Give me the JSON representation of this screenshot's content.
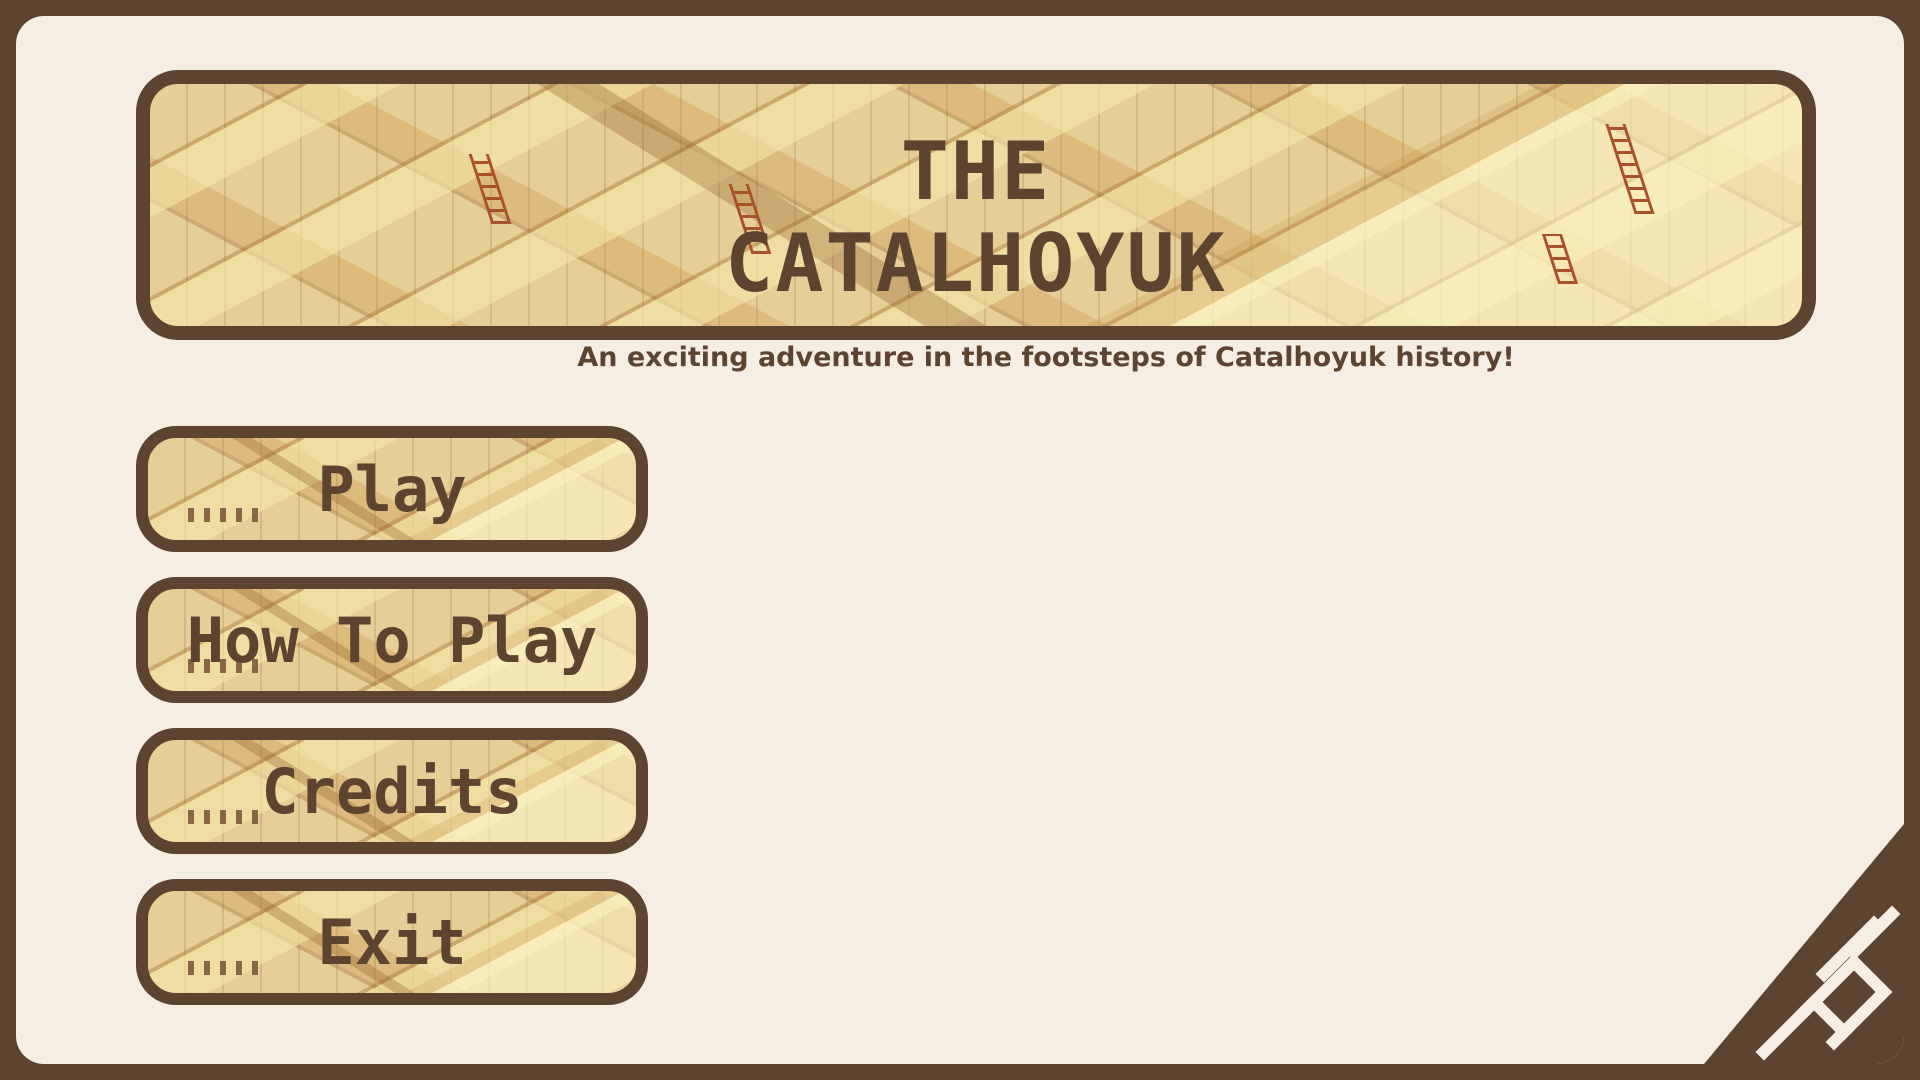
{
  "banner": {
    "title_line1": "THE",
    "title_line2": "CATALHOYUK",
    "subtitle": "An exciting adventure in the footsteps of Catalhoyuk history!"
  },
  "menu": {
    "items": [
      {
        "label": "Play"
      },
      {
        "label": "How To Play"
      },
      {
        "label": "Credits"
      },
      {
        "label": "Exit"
      }
    ]
  },
  "colors": {
    "frame": "#5c4430",
    "background": "#f6eee2",
    "text": "#5c4430",
    "town": "#e6cf96"
  }
}
